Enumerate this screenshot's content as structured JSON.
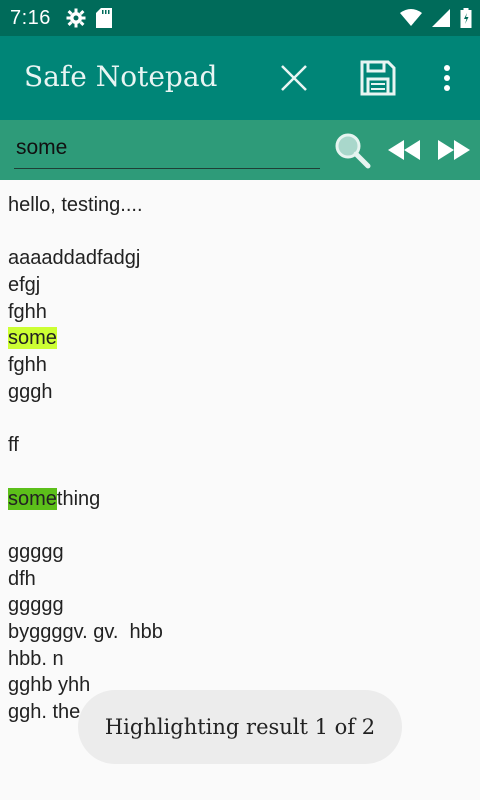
{
  "status_bar": {
    "time": "7:16",
    "left_icons": [
      "gear-icon",
      "sd-card-icon"
    ],
    "right_icons": [
      "wifi-icon",
      "signal-icon",
      "battery-icon"
    ]
  },
  "toolbar": {
    "title": "Safe Notepad",
    "actions": [
      "close-icon",
      "save-icon",
      "more-vert-icon"
    ]
  },
  "search": {
    "value": "some",
    "placeholder": "",
    "buttons": [
      "search-icon",
      "previous-result-icon",
      "next-result-icon"
    ]
  },
  "note": {
    "lines": [
      "hello, testing....",
      "",
      "aaaaddadfadgj",
      "efgj",
      "fghh",
      "some",
      "fghh",
      "gggh",
      "",
      "ff",
      "",
      "something",
      "",
      "ggggg",
      "dfh",
      "ggggg",
      "byggggv. gv.  hbb",
      "hbb. n",
      "gghb yhh",
      "ggh. the"
    ],
    "highlight_current_text": "some",
    "highlight_other_prefix": "some",
    "highlight_other_suffix": "thing"
  },
  "toast": {
    "message": "Highlighting result 1 of 2"
  },
  "colors": {
    "status_bar": "#006b5a",
    "toolbar": "#008577",
    "search_bar": "#2e9b79",
    "highlight_current": "#ccff33",
    "highlight_other": "#5cbf1a"
  }
}
